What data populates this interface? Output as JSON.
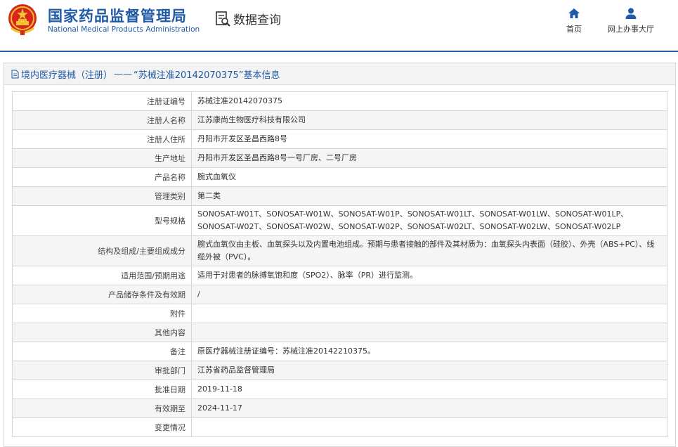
{
  "header": {
    "site_name_cn": "国家药品监督管理局",
    "site_name_en": "National Medical Products Administration",
    "query_label": "数据查询",
    "nav": [
      {
        "label": "首页",
        "icon": "home-icon"
      },
      {
        "label": "网上办事大厅",
        "icon": "user-icon"
      }
    ]
  },
  "panel": {
    "category": "境内医疗器械（注册）",
    "separator": "——",
    "title": "“苏械注准20142070375”基本信息"
  },
  "colors": {
    "brand": "#1f5aa6",
    "header_line": "#1f5fa0",
    "alt_row": "#f5f5f5"
  },
  "rows": [
    {
      "label": "注册证编号",
      "value": "苏械注准20142070375"
    },
    {
      "label": "注册人名称",
      "value": "江苏康尚生物医疗科技有限公司"
    },
    {
      "label": "注册人住所",
      "value": "丹阳市开发区圣昌西路8号"
    },
    {
      "label": "生产地址",
      "value": "丹阳市开发区圣昌西路8号一号厂房、二号厂房"
    },
    {
      "label": "产品名称",
      "value": "腕式血氧仪"
    },
    {
      "label": "管理类别",
      "value": "第二类"
    },
    {
      "label": "型号规格",
      "value": "SONOSAT-W01T、SONOSAT-W01W、SONOSAT-W01P、SONOSAT-W01LT、SONOSAT-W01LW、SONOSAT-W01LP、SONOSAT-W02T、SONOSAT-W02W、SONOSAT-W02P、SONOSAT-W02LT、SONOSAT-W02LW、SONOSAT-W02LP"
    },
    {
      "label": "结构及组成/主要组成成分",
      "value": "腕式血氧仪由主板、血氧探头以及内置电池组成。预期与患者接触的部件及其材质为：血氧探头内表面（硅胶）、外壳（ABS+PC）、线缆外被（PVC）。"
    },
    {
      "label": "适用范围/预期用途",
      "value": "适用于对患者的脉搏氧饱和度（SPO2）、脉率（PR）进行监测。"
    },
    {
      "label": "产品储存条件及有效期",
      "value": "/"
    },
    {
      "label": "附件",
      "value": ""
    },
    {
      "label": "其他内容",
      "value": ""
    },
    {
      "label": "备注",
      "value": "原医疗器械注册证编号：苏械注准20142210375。"
    },
    {
      "label": "审批部门",
      "value": "江苏省药品监督管理局"
    },
    {
      "label": "批准日期",
      "value": "2019-11-18"
    },
    {
      "label": "有效期至",
      "value": "2024-11-17"
    },
    {
      "label": "变更情况",
      "value": ""
    }
  ]
}
